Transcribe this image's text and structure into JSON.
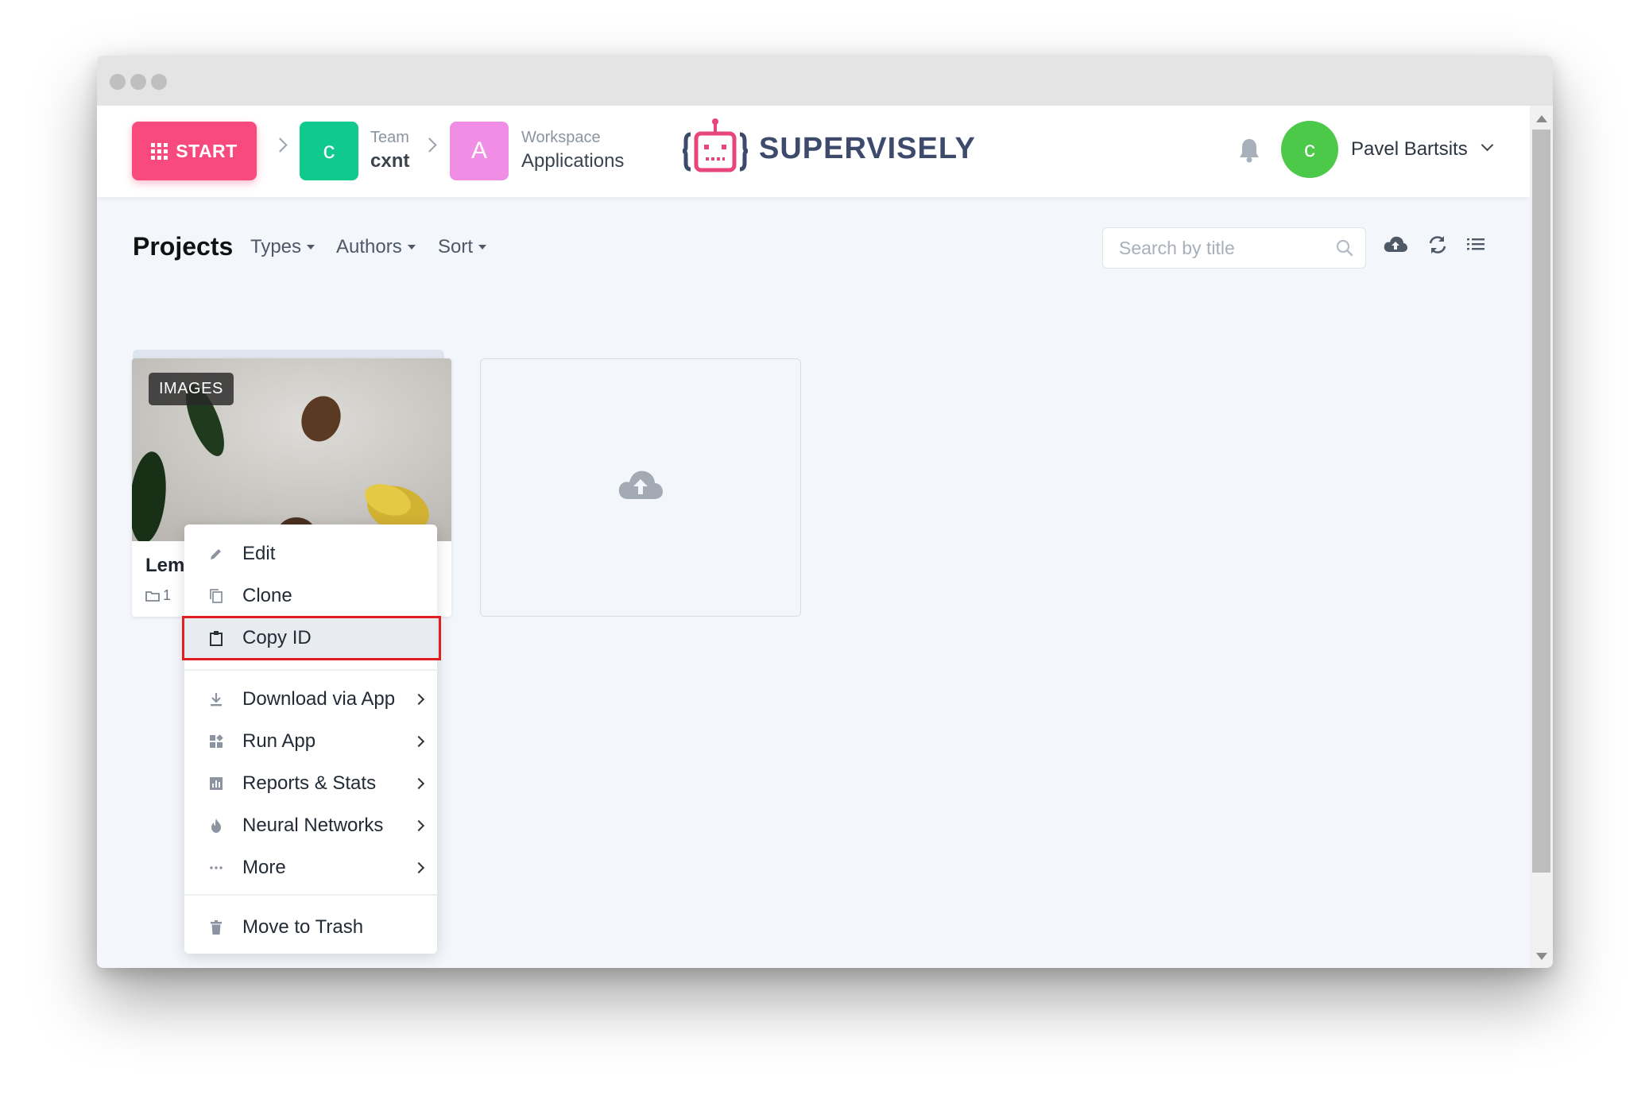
{
  "header": {
    "start_label": "START",
    "team": {
      "badge": "c",
      "caption": "Team",
      "name": "cxnt",
      "color": "#10c98c"
    },
    "workspace": {
      "badge": "A",
      "caption": "Workspace",
      "name": "Applications",
      "color": "#f08ee6"
    },
    "logo_text": "SUPERVISELY",
    "user": {
      "avatar_letter": "c",
      "name": "Pavel Bartsits",
      "avatar_color": "#4dc94a"
    }
  },
  "toolbar": {
    "title": "Projects",
    "filters": [
      "Types",
      "Authors",
      "Sort"
    ],
    "search_placeholder": "Search by title",
    "icons": [
      "upload-cloud-icon",
      "refresh-icon",
      "list-view-icon"
    ]
  },
  "project_card": {
    "badge": "IMAGES",
    "title": "Lemons (Annotated)",
    "datasets_count": "1"
  },
  "context_menu": {
    "items": [
      {
        "label": "Edit",
        "icon": "pencil-icon",
        "submenu": false
      },
      {
        "label": "Clone",
        "icon": "copy-icon",
        "submenu": false
      },
      {
        "label": "Copy ID",
        "icon": "clipboard-icon",
        "submenu": false,
        "highlighted": true
      },
      {
        "label": "Download via App",
        "icon": "download-icon",
        "submenu": true
      },
      {
        "label": "Run App",
        "icon": "apps-icon",
        "submenu": true
      },
      {
        "label": "Reports & Stats",
        "icon": "chart-icon",
        "submenu": true
      },
      {
        "label": "Neural Networks",
        "icon": "flame-icon",
        "submenu": true
      },
      {
        "label": "More",
        "icon": "more-dots-icon",
        "submenu": true
      },
      {
        "label": "Move to Trash",
        "icon": "trash-icon",
        "submenu": false
      }
    ]
  },
  "colors": {
    "accent": "#f94a7d",
    "highlight_border": "#e02020",
    "page_bg": "#f3f6fb"
  }
}
